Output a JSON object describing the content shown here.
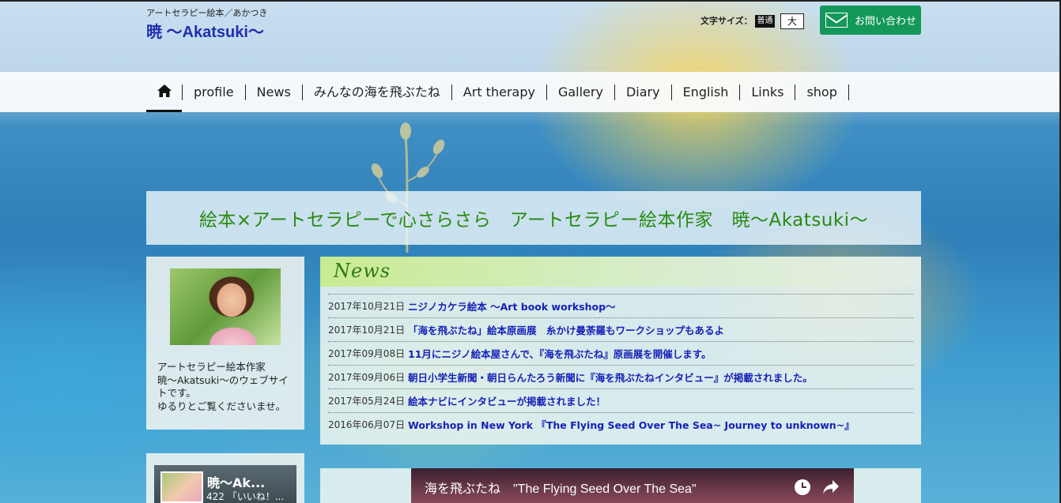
{
  "header": {
    "subtitle": "アートセラピー絵本／あかつき",
    "title": "暁 〜Akatsuki〜",
    "font_size_label": "文字サイズ：",
    "font_size_normal": "普通",
    "font_size_large": "大",
    "contact_label": "お問い合わせ"
  },
  "nav": {
    "items": [
      {
        "label": "profile"
      },
      {
        "label": "News"
      },
      {
        "label": "みんなの海を飛ぶたね"
      },
      {
        "label": "Art therapy"
      },
      {
        "label": "Gallery"
      },
      {
        "label": "Diary"
      },
      {
        "label": "English"
      },
      {
        "label": "Links"
      },
      {
        "label": "shop"
      }
    ]
  },
  "tagline": "絵本×アートセラピーで心さらさら　アートセラピー絵本作家　暁〜Akatsuki〜",
  "profile": {
    "lines": [
      "アートセラピー絵本作家",
      "暁〜Akatsuki〜のウェブサイトです。",
      "ゆるりとご覧くださいませ。"
    ]
  },
  "facebook": {
    "name": "暁〜Ak...",
    "likes": "422 「いいね！..."
  },
  "news": {
    "heading": "News",
    "items": [
      {
        "date": "2017年10月21日",
        "title": "ニジノカケラ絵本 〜Art book workshop〜"
      },
      {
        "date": "2017年10月21日",
        "title": "「海を飛ぶたね」絵本原画展　糸かけ曼荼羅もワークショップもあるよ"
      },
      {
        "date": "2017年09月08日",
        "title": "11月にニジノ絵本屋さんで、『海を飛ぶたね』原画展を開催します。"
      },
      {
        "date": "2017年09月06日",
        "title": "朝日小学生新聞・朝日らんたろう新聞に『海を飛ぶたねインタビュー』が掲載されました。"
      },
      {
        "date": "2017年05月24日",
        "title": "絵本ナビにインタビューが掲載されました！"
      },
      {
        "date": "2016年06月07日",
        "title": "Workshop in New York 『The Flying Seed Over The Sea~ Journey to unknown~』"
      }
    ]
  },
  "video": {
    "title": "海を飛ぶたね　\"The Flying Seed Over The Sea\""
  },
  "icons": {
    "home": "home-icon",
    "mail": "mail-icon",
    "clock": "clock-icon",
    "share": "share-icon"
  },
  "colors": {
    "title_blue": "#1f2fb0",
    "tagline_green": "#2a8a12",
    "contact_green": "#13985a",
    "link_blue": "#1622b8"
  }
}
